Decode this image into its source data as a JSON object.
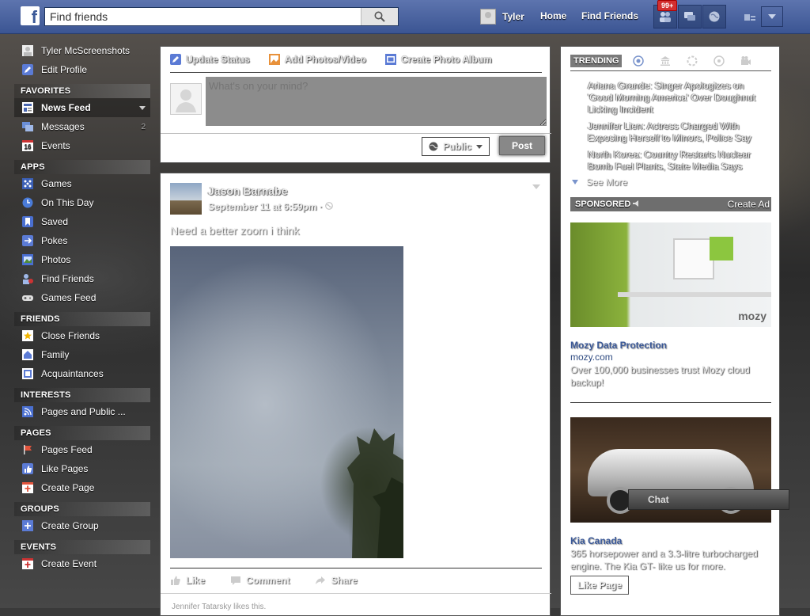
{
  "topbar": {
    "logo": "f",
    "search_placeholder": "Find friends",
    "user_name": "Tyler",
    "home": "Home",
    "find_friends": "Find Friends",
    "notifications_badge": "99+"
  },
  "sidebar": {
    "profile": [
      {
        "label": "Tyler McScreenshots",
        "icon": "avatar"
      },
      {
        "label": "Edit Profile",
        "icon": "pencil-icon"
      }
    ],
    "sections": [
      {
        "title": "FAVORITES",
        "items": [
          {
            "label": "News Feed",
            "icon": "news-feed-icon",
            "active": true
          },
          {
            "label": "Messages",
            "icon": "messages-icon",
            "count": "2"
          },
          {
            "label": "Events",
            "icon": "calendar-icon",
            "date": "16"
          }
        ]
      },
      {
        "title": "APPS",
        "items": [
          {
            "label": "Games",
            "icon": "games-icon"
          },
          {
            "label": "On This Day",
            "icon": "clock-icon"
          },
          {
            "label": "Saved",
            "icon": "bookmark-icon"
          },
          {
            "label": "Pokes",
            "icon": "poke-icon"
          },
          {
            "label": "Photos",
            "icon": "photos-icon"
          },
          {
            "label": "Find Friends",
            "icon": "friends-icon"
          },
          {
            "label": "Games Feed",
            "icon": "gamepad-icon"
          }
        ]
      },
      {
        "title": "FRIENDS",
        "items": [
          {
            "label": "Close Friends",
            "icon": "star-icon"
          },
          {
            "label": "Family",
            "icon": "house-icon"
          },
          {
            "label": "Acquaintances",
            "icon": "acquaintances-icon"
          }
        ]
      },
      {
        "title": "INTERESTS",
        "items": [
          {
            "label": "Pages and Public ...",
            "icon": "rss-icon"
          }
        ]
      },
      {
        "title": "PAGES",
        "items": [
          {
            "label": "Pages Feed",
            "icon": "flag-icon"
          },
          {
            "label": "Like Pages",
            "icon": "thumbs-up-icon"
          },
          {
            "label": "Create Page",
            "icon": "plus-icon"
          }
        ]
      },
      {
        "title": "GROUPS",
        "items": [
          {
            "label": "Create Group",
            "icon": "plus-icon"
          }
        ]
      },
      {
        "title": "EVENTS",
        "items": [
          {
            "label": "Create Event",
            "icon": "plus-icon"
          }
        ]
      }
    ]
  },
  "composer": {
    "tabs": [
      {
        "label": "Update Status",
        "icon": "pencil-icon"
      },
      {
        "label": "Add Photos/Video",
        "icon": "photo-icon"
      },
      {
        "label": "Create Photo Album",
        "icon": "album-icon"
      }
    ],
    "placeholder": "What's on your mind?",
    "privacy": "Public",
    "post": "Post"
  },
  "story": {
    "author": "Jason Barnabe",
    "time": "September 11 at 6:59pm · ",
    "text": "Need a better zoom i think",
    "actions": [
      "Like",
      "Comment",
      "Share"
    ],
    "likes": "Jennifer Tatarsky likes this."
  },
  "trending": {
    "title": "TRENDING",
    "items": [
      "Ariana Grande: Singer Apologizes on 'Good Morning America' Over Doughnut Licking Incident",
      "Jennifer Lien: Actress Charged With Exposing Herself to Minors, Police Say",
      "North Korea: Country Restarts Nuclear Bomb Fuel Plants, State Media Says"
    ],
    "see_more": "See More"
  },
  "sponsored": {
    "title": "SPONSORED",
    "create_ad": "Create Ad",
    "ads": [
      {
        "title": "Mozy Data Protection",
        "url": "mozy.com",
        "desc": "Over 100,000 businesses trust Mozy cloud backup!",
        "logo": "mozy"
      },
      {
        "title": "Kia Canada",
        "desc": "365 horsepower and a 3.3-litre turbocharged engine. The Kia GT- like us for more.",
        "button": "Like Page"
      }
    ]
  },
  "chat": {
    "label": "Chat"
  }
}
